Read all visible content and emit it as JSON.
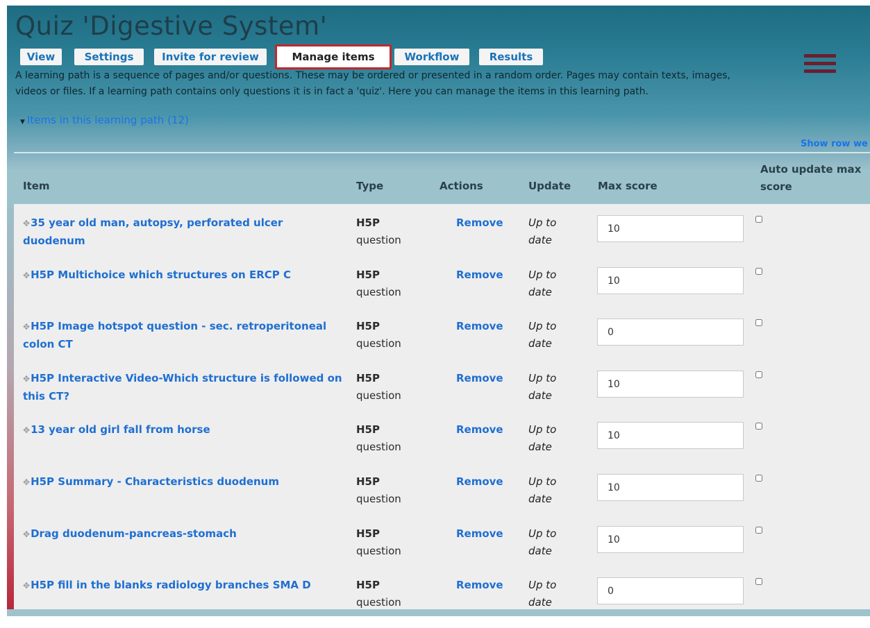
{
  "page_title": "Quiz 'Digestive System'",
  "tabs": [
    {
      "label": "View"
    },
    {
      "label": "Settings"
    },
    {
      "label": "Invite for review"
    },
    {
      "label": "Manage items",
      "active": true
    },
    {
      "label": "Workflow"
    },
    {
      "label": "Results"
    }
  ],
  "intro": {
    "line1": "A learning path is a sequence of pages and/or questions. These may be ordered or presented in a random order. Pages may contain texts, images,",
    "line2": "videos or files. If a learning path contains only questions it is in fact a 'quiz'. Here you can manage the items in this learning path."
  },
  "items_section": {
    "label": "Items in this learning path (12)"
  },
  "show_row_weights": "Show row we",
  "table": {
    "headers": {
      "item": "Item",
      "type": "Type",
      "actions": "Actions",
      "update": "Update",
      "max_score": "Max score",
      "auto_update_line1": "Auto update max",
      "auto_update_line2": "score"
    },
    "rows": [
      {
        "title_line1": "35 year old man, autopsy, perforated ulcer",
        "title_line2": "duodenum",
        "type_line1": "H5P",
        "type_line2": "question",
        "action": "Remove",
        "update_line1": "Up to",
        "update_line2": "date",
        "max_score": "10",
        "auto_update": false
      },
      {
        "title_line1": "H5P Multichoice which structures on ERCP C",
        "title_line2": "",
        "type_line1": "H5P",
        "type_line2": "question",
        "action": "Remove",
        "update_line1": "Up to",
        "update_line2": "date",
        "max_score": "10",
        "auto_update": false
      },
      {
        "title_line1": "H5P Image hotspot question - sec. retroperitoneal",
        "title_line2": "colon CT",
        "type_line1": "H5P",
        "type_line2": "question",
        "action": "Remove",
        "update_line1": "Up to",
        "update_line2": "date",
        "max_score": "0",
        "auto_update": false
      },
      {
        "title_line1": "H5P Interactive Video-Which structure is followed on",
        "title_line2": "this CT?",
        "type_line1": "H5P",
        "type_line2": "question",
        "action": "Remove",
        "update_line1": "Up to",
        "update_line2": "date",
        "max_score": "10",
        "auto_update": false
      },
      {
        "title_line1": "13 year old girl fall from horse",
        "title_line2": "",
        "type_line1": "H5P",
        "type_line2": "question",
        "action": "Remove",
        "update_line1": "Up to",
        "update_line2": "date",
        "max_score": "10",
        "auto_update": false
      },
      {
        "title_line1": "H5P Summary - Characteristics duodenum",
        "title_line2": "",
        "type_line1": "H5P",
        "type_line2": "question",
        "action": "Remove",
        "update_line1": "Up to",
        "update_line2": "date",
        "max_score": "10",
        "auto_update": false
      },
      {
        "title_line1": "Drag duodenum-pancreas-stomach",
        "title_line2": "",
        "type_line1": "H5P",
        "type_line2": "question",
        "action": "Remove",
        "update_line1": "Up to",
        "update_line2": "date",
        "max_score": "10",
        "auto_update": false
      },
      {
        "title_line1": "H5P fill in the blanks radiology branches SMA D",
        "title_line2": "",
        "type_line1": "H5P",
        "type_line2": "question",
        "action": "Remove",
        "update_line1": "Up to",
        "update_line2": "date",
        "max_score": "0",
        "auto_update": false
      }
    ]
  }
}
